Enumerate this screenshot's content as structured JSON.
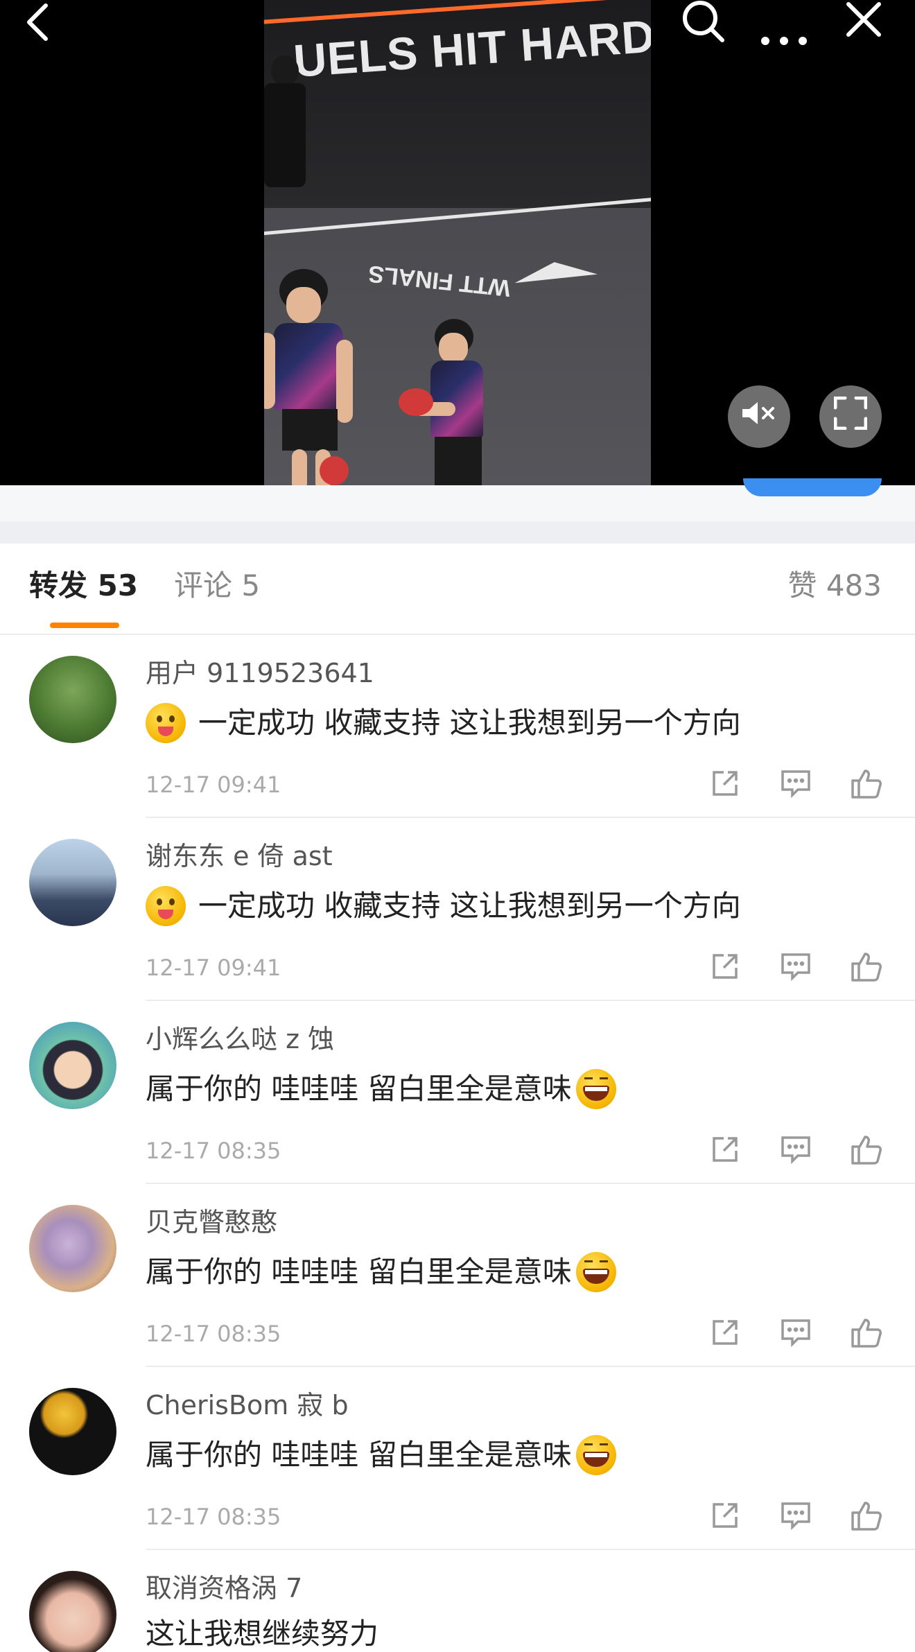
{
  "video": {
    "banner_text": "UELS HIT HARDE",
    "court_logo": "WTT FINALS",
    "top_icons": [
      "back-icon",
      "search-icon",
      "more-icon",
      "close-icon"
    ],
    "controls": [
      "mute-icon",
      "fullscreen-icon"
    ]
  },
  "tabs": {
    "repost": "转发 53",
    "comment": "评论 5",
    "like": "赞 483",
    "active": "repost"
  },
  "reposts": [
    {
      "user": "用户 9119523641",
      "emoji": "tongue-out-emoji",
      "text": "一定成功 收藏支持 这让我想到另一个方向",
      "time": "12-17 09:41"
    },
    {
      "user": "谢东东 e 倚 ast",
      "emoji": "tongue-out-emoji",
      "text": "一定成功 收藏支持 这让我想到另一个方向",
      "time": "12-17 09:41"
    },
    {
      "user": "小辉么么哒 z 蚀",
      "emoji": "laughing-emoji",
      "text": "属于你的 哇哇哇 留白里全是意味",
      "time": "12-17 08:35"
    },
    {
      "user": "贝克瞥憨憨",
      "emoji": "laughing-emoji",
      "text": "属于你的 哇哇哇 留白里全是意味",
      "time": "12-17 08:35"
    },
    {
      "user": "CherisBom 寂 b",
      "emoji": "laughing-emoji",
      "text": "属于你的 哇哇哇 留白里全是意味",
      "time": "12-17 08:35"
    },
    {
      "user": "取消资格涡 7",
      "text": "这让我想继续努力"
    }
  ],
  "colors": {
    "accent": "#ff8200",
    "video_bg": "#000000",
    "muted_text": "#888888",
    "time_text": "#aaaaaa"
  }
}
